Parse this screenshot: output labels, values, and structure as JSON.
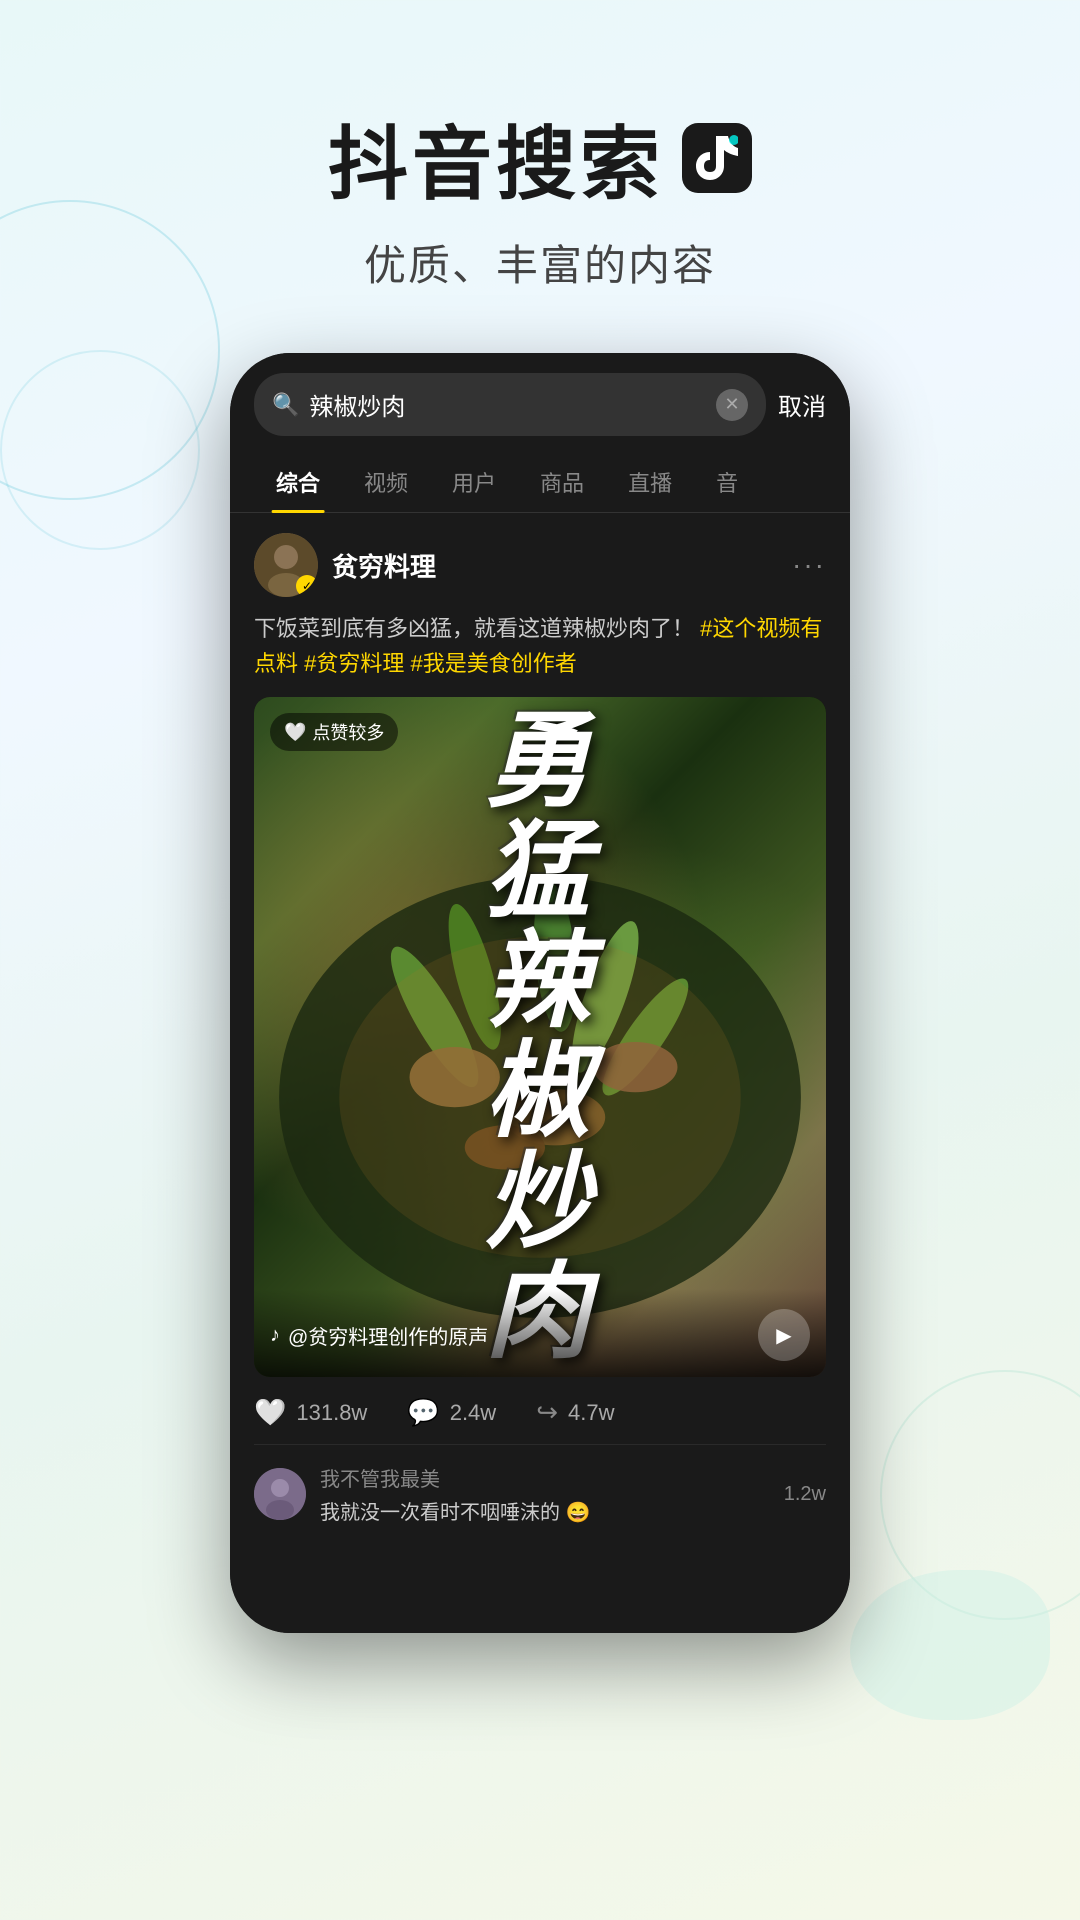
{
  "header": {
    "title": "抖音搜索",
    "subtitle": "优质、丰富的内容",
    "tiktok_icon_note": "♪"
  },
  "phone": {
    "search": {
      "placeholder": "辣椒炒肉",
      "current_value": "辣椒炒肉",
      "cancel_label": "取消"
    },
    "tabs": [
      {
        "label": "综合",
        "active": true
      },
      {
        "label": "视频",
        "active": false
      },
      {
        "label": "用户",
        "active": false
      },
      {
        "label": "商品",
        "active": false
      },
      {
        "label": "直播",
        "active": false
      },
      {
        "label": "音",
        "active": false
      }
    ],
    "post": {
      "username": "贫穷料理",
      "verified": true,
      "description_normal": "下饭菜到底有多凶猛，就看这道辣椒炒肉了！",
      "description_hashtags": "#这个视频有点料 #贫穷料理 #我是美食创作者",
      "badge_text": "点赞较多",
      "video_title": "勇猛辣椒炒肉",
      "sound_info": "@贫穷料理创作的原声",
      "stats": {
        "likes": "131.8w",
        "comments": "2.4w",
        "shares": "4.7w"
      },
      "comment": {
        "author": "我不管我最美",
        "text": "我就没一次看时不咽唾沫的 😄",
        "likes": "1.2w"
      }
    }
  }
}
